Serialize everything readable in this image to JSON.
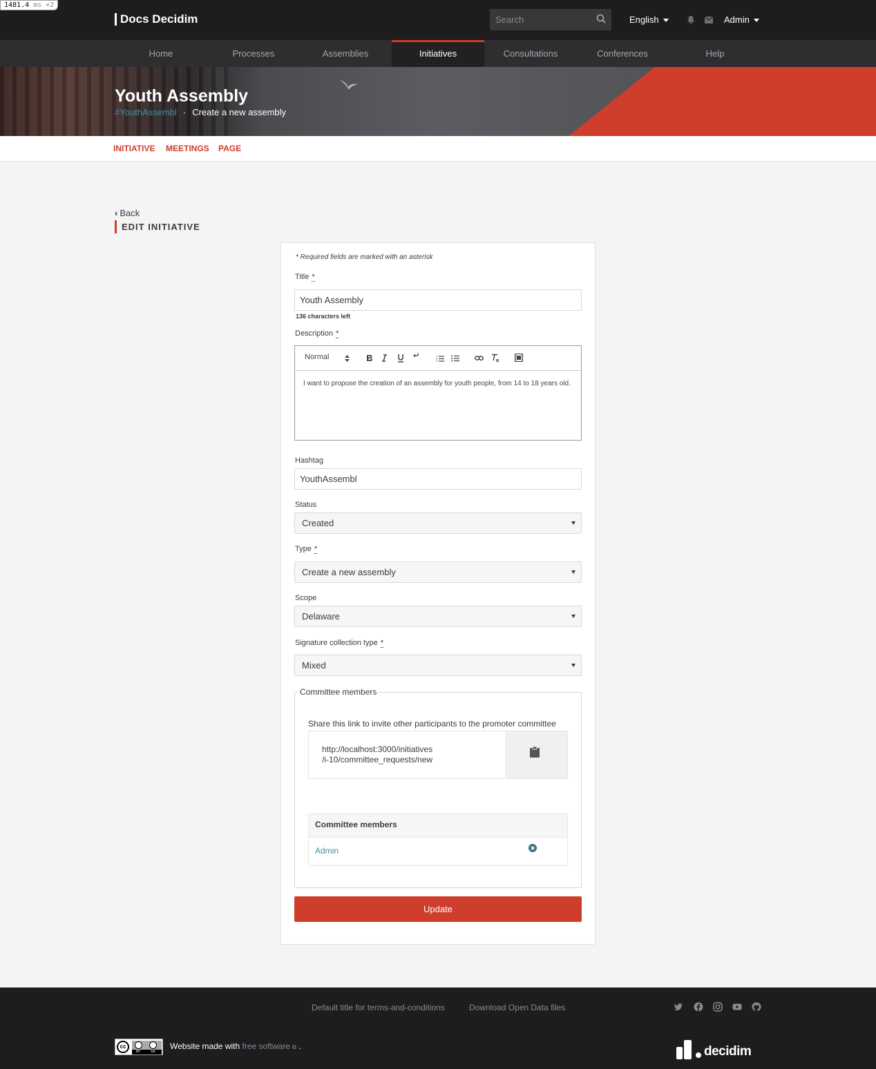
{
  "debug": {
    "time": "1481.4",
    "unit": "ms",
    "mult": "×2"
  },
  "topbar": {
    "brand": "Docs Decidim",
    "search_placeholder": "Search",
    "language": "English",
    "user": "Admin"
  },
  "nav": {
    "items": [
      "Home",
      "Processes",
      "Assemblies",
      "Initiatives",
      "Consultations",
      "Conferences",
      "Help"
    ],
    "active": "Initiatives"
  },
  "hero": {
    "title": "Youth Assembly",
    "hashtag": "#YouthAssembl",
    "separator": "·",
    "type": "Create a new assembly"
  },
  "subnav": {
    "items": [
      "INITIATIVE",
      "MEETINGS",
      "PAGE"
    ]
  },
  "page": {
    "back": "Back",
    "back_chevron": "‹",
    "section_title": "EDIT INITIATIVE"
  },
  "form": {
    "required_note": "* Required fields are marked with an asterisk",
    "required_marker": "*",
    "title_label": "Title",
    "title_value": "Youth Assembly",
    "chars_left": "136 characters left",
    "description_label": "Description",
    "editor_style": "Normal",
    "description_value": "I want to propose the creation of an assembly for youth people, from 14 to 18 years old.",
    "hashtag_label": "Hashtag",
    "hashtag_value": "YouthAssembl",
    "status_label": "Status",
    "status_value": "Created",
    "type_label": "Type",
    "type_value": "Create a new assembly",
    "scope_label": "Scope",
    "scope_value": "Delaware",
    "signature_label": "Signature collection type",
    "signature_value": "Mixed",
    "committee": {
      "legend": "Committee members",
      "share_text": "Share this link to invite other participants to the promoter committee",
      "link_line1": "http://localhost:3000/initiatives",
      "link_line2": "/i-10/committee_requests/new",
      "table_header": "Committee members",
      "members": [
        "Admin"
      ]
    },
    "submit": "Update"
  },
  "footer": {
    "links": [
      "Default title for terms-and-conditions",
      "Download Open Data files"
    ],
    "social": [
      "twitter-icon",
      "facebook-icon",
      "instagram-icon",
      "youtube-icon",
      "github-icon"
    ],
    "made_with_prefix": "Website made with",
    "made_with_link": "free software",
    "made_with_suffix": ".",
    "logo_text": "decidim",
    "cc": {
      "mark": "cc",
      "by": "BY",
      "sa": "SA"
    }
  },
  "colors": {
    "accent": "#cf3d2c",
    "link": "#3b8fa6",
    "topbar": "#1e1c1f"
  }
}
